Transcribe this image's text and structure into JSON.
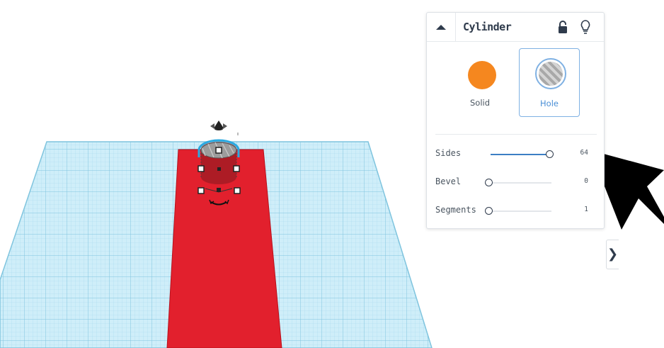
{
  "inspector": {
    "shape_name": "Cylinder",
    "collapse_icon": "chevron-up-icon",
    "lock_icon": "unlock-icon",
    "light_icon": "lightbulb-icon",
    "solid_label": "Solid",
    "hole_label": "Hole",
    "selected_type": "Hole",
    "solid_color": "#f5871f",
    "properties": [
      {
        "label": "Sides",
        "value": "64",
        "level": 0.9
      },
      {
        "label": "Bevel",
        "value": "0",
        "level": 0
      },
      {
        "label": "Segments",
        "value": "1",
        "level": 0
      }
    ]
  },
  "sidebar_toggle": {
    "icon": "chevron-right-icon",
    "glyph": "❯"
  },
  "workplane": {
    "grid_color": "#b9e3f2",
    "object_color": "#e2202d",
    "selection_color": "#2aa9e0"
  },
  "cursor": {
    "icon": "pointer-arrow-icon"
  }
}
